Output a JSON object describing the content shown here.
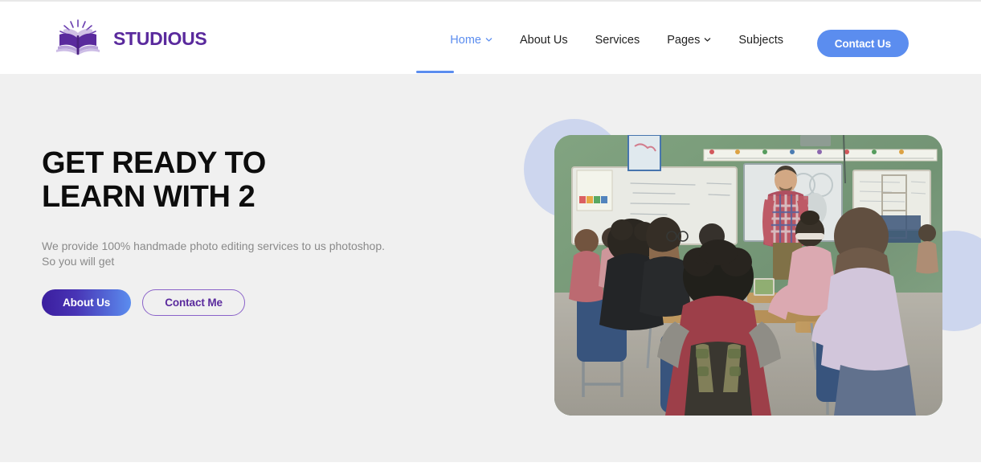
{
  "brand": {
    "name": "STUDIOUS",
    "logo_icon": "open-book-with-sun-rays-icon",
    "logo_color": "#5A2A9D"
  },
  "nav": {
    "items": [
      {
        "label": "Home",
        "has_dropdown": true,
        "active": true
      },
      {
        "label": "About Us",
        "has_dropdown": false,
        "active": false
      },
      {
        "label": "Services",
        "has_dropdown": false,
        "active": false
      },
      {
        "label": "Pages",
        "has_dropdown": true,
        "active": false
      },
      {
        "label": "Subjects",
        "has_dropdown": false,
        "active": false
      }
    ],
    "cta": {
      "label": "Contact Us",
      "color": "#5B8DEF"
    },
    "active_color": "#5B8DEF",
    "text_color": "#222222"
  },
  "hero": {
    "title_line1": "GET READY TO",
    "title_line2": "LEARN WITH 2",
    "subtitle": "We provide 100% handmade photo editing services to us photoshop. So you will get",
    "buttons": {
      "primary": {
        "label": "About Us",
        "gradient_from": "#3B1E9E",
        "gradient_to": "#5B8DEF"
      },
      "outline": {
        "label": "Contact Me",
        "border_color": "#8b63c9",
        "text_color": "#5A2A9D"
      }
    },
    "background_color": "#f0f0f0",
    "decoration_circle_color": "#cdd6ee",
    "photo_alt": "classroom-students-listening-to-teacher"
  }
}
